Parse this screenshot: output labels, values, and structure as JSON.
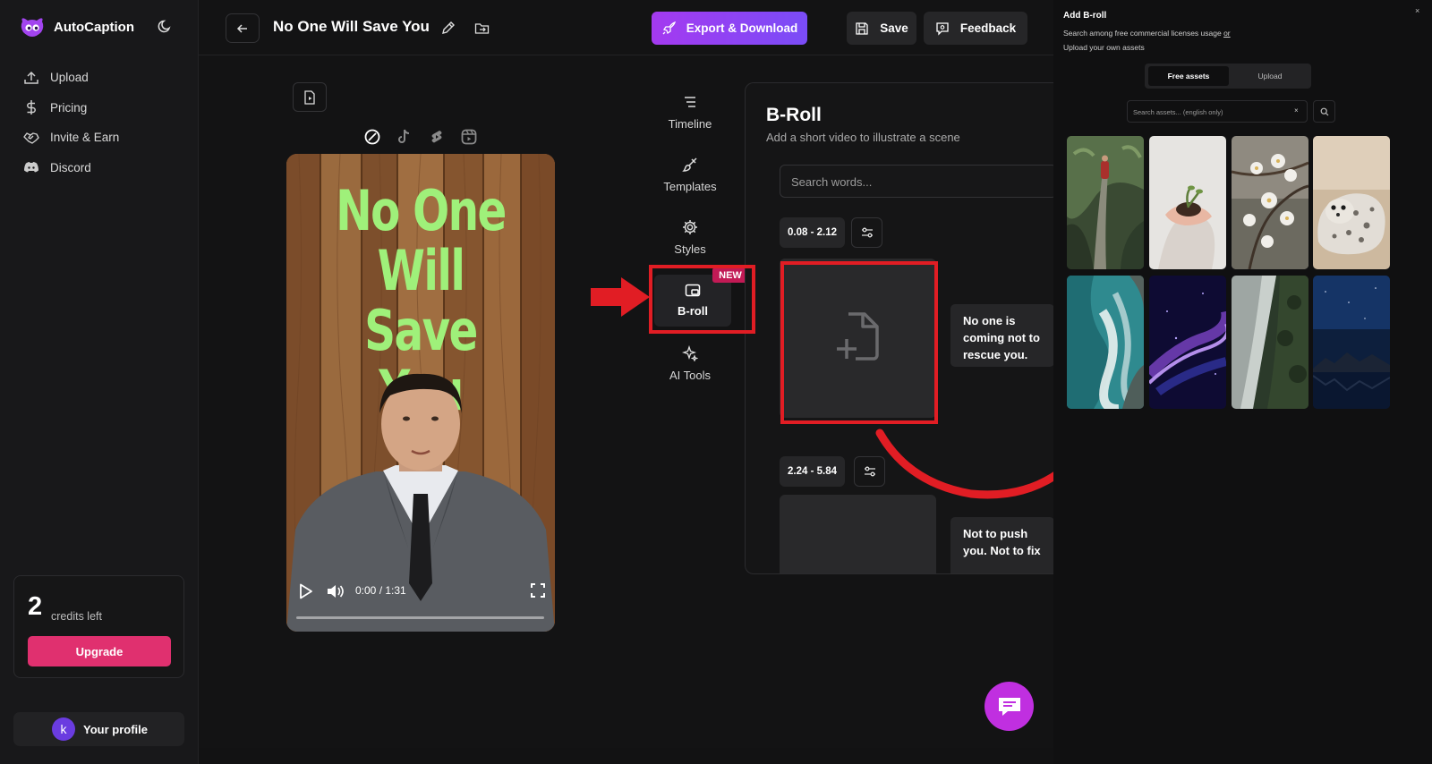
{
  "app": {
    "name": "AutoCaption"
  },
  "sidebar": {
    "items": [
      {
        "label": "Upload",
        "icon": "upload-icon"
      },
      {
        "label": "Pricing",
        "icon": "dollar-icon"
      },
      {
        "label": "Invite & Earn",
        "icon": "handshake-icon"
      },
      {
        "label": "Discord",
        "icon": "discord-icon"
      }
    ],
    "credits": {
      "count": "2",
      "label": "credits left"
    },
    "upgrade_label": "Upgrade",
    "profile": {
      "initial": "k",
      "label": "Your profile"
    }
  },
  "topbar": {
    "project_title": "No One Will Save You",
    "export_label": "Export & Download",
    "save_label": "Save",
    "feedback_label": "Feedback"
  },
  "preview": {
    "caption_lines": [
      "No One",
      "Will Save",
      "You"
    ],
    "time": "0:00 / 1:31",
    "progress": 0
  },
  "tools": [
    {
      "label": "Timeline",
      "icon": "timeline-icon"
    },
    {
      "label": "Templates",
      "icon": "brush-icon"
    },
    {
      "label": "Styles",
      "icon": "gear-icon"
    },
    {
      "label": "B-roll",
      "icon": "broll-icon",
      "badge": "NEW",
      "active": true
    },
    {
      "label": "AI Tools",
      "icon": "sparkles-icon"
    }
  ],
  "broll_panel": {
    "title": "B-Roll",
    "subtitle": "Add a short video to illustrate a scene",
    "search_placeholder": "Search words...",
    "segments": [
      {
        "range": "0.08 - 2.12",
        "text": "No one is coming not to rescue you."
      },
      {
        "range": "2.24 - 5.84",
        "text": "Not to push you. Not to fix"
      }
    ]
  },
  "add_broll": {
    "title": "Add B-roll",
    "description_prefix": "Search among free commercial licenses usage ",
    "description_link": "or",
    "upload_own": "Upload your own assets",
    "tabs": [
      "Free assets",
      "Upload"
    ],
    "search_placeholder": "Search assets... (english only)",
    "clear": "×",
    "close": "×",
    "thumbnails": [
      "forest-woman",
      "hands-plant",
      "white-blossoms",
      "seal-on-sand",
      "ocean-waves-aerial",
      "purple-particles",
      "river-forest-aerial",
      "night-mountains"
    ]
  },
  "colors": {
    "accent": "#a43af0",
    "upgrade": "#e0306f",
    "badge": "#c21a55",
    "caption": "#9ff07a",
    "annotation": "#e11d24"
  }
}
